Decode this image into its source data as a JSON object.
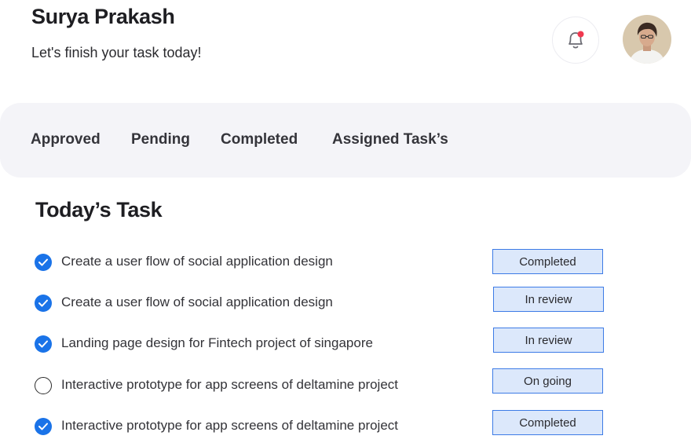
{
  "header": {
    "user_name": "Surya Prakash",
    "greeting": "Let's finish your task today!",
    "notification_icon": "bell-icon",
    "notification_dot_color": "#f0384f"
  },
  "tabs": [
    {
      "label": "Approved"
    },
    {
      "label": "Pending"
    },
    {
      "label": "Completed"
    },
    {
      "label": "Assigned Task’s"
    }
  ],
  "todays_task": {
    "title": "Today’s Task",
    "tasks": [
      {
        "text": "Create a user flow of social application design",
        "status": "Completed",
        "checked": true
      },
      {
        "text": "Create a user flow of social application design",
        "status": "In review",
        "checked": true
      },
      {
        "text": "Landing page design for Fintech project of singapore",
        "status": "In review",
        "checked": true
      },
      {
        "text": "Interactive prototype for app screens of deltamine project",
        "status": "On going",
        "checked": false
      },
      {
        "text": "Interactive prototype for app screens of deltamine project",
        "status": "Completed",
        "checked": true
      }
    ]
  },
  "colors": {
    "accent": "#1a73e8",
    "badge_border": "#3d7be6",
    "badge_fill": "#dce8fb",
    "tab_bar_bg": "#f4f4f8"
  }
}
